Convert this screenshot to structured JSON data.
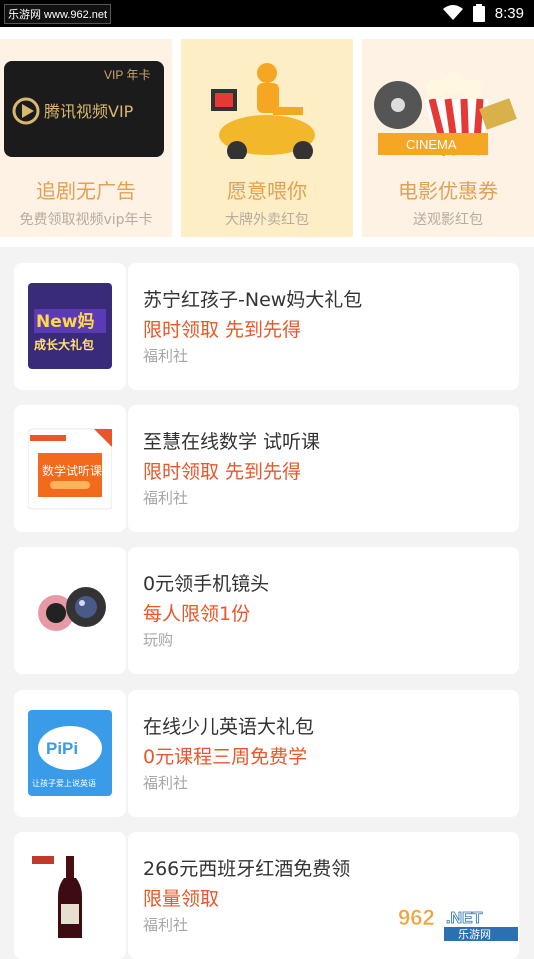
{
  "status_bar": {
    "site_label": "乐游网 www.962.net",
    "time": "8:39"
  },
  "promos": [
    {
      "title": "追剧无广告",
      "subtitle": "免费领取视频vip年卡",
      "image_text": "VIP 年卡",
      "image_brand": "腾讯视频VIP"
    },
    {
      "title": "愿意喂你",
      "subtitle": "大牌外卖红包"
    },
    {
      "title": "电影优惠券",
      "subtitle": "送观影红包",
      "image_text": "CINEMA"
    }
  ],
  "items": [
    {
      "title": "苏宁红孩子-New妈大礼包",
      "promo": "限时领取 先到先得",
      "tag": "福利社",
      "thumb_text_1": "New妈",
      "thumb_text_2": "成长大礼包"
    },
    {
      "title": "至慧在线数学 试听课",
      "promo": "限时领取 先到先得",
      "tag": "福利社",
      "thumb_text_1": "数学试听课"
    },
    {
      "title": "0元领手机镜头",
      "promo": "每人限领1份",
      "tag": "玩购"
    },
    {
      "title": "在线少儿英语大礼包",
      "promo": "0元课程三周免费学",
      "tag": "福利社",
      "thumb_text_1": "PiPi",
      "thumb_text_2": "让孩子爱上说英语"
    },
    {
      "title": "266元西班牙红酒免费领",
      "promo": "限量领取",
      "tag": "福利社"
    }
  ],
  "watermark": {
    "number": "962",
    "suffix": ".NET",
    "name": "乐游网"
  },
  "colors": {
    "accent": "#e8572a",
    "promo_gold": "#e0a155"
  }
}
